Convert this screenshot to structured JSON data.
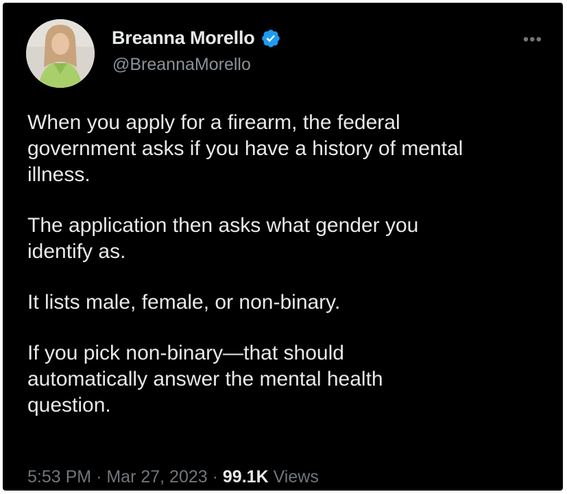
{
  "author": {
    "display_name": "Breanna Morello",
    "handle": "@BreannaMorello",
    "verified": true,
    "verified_color": "#1d9bf0"
  },
  "tweet": {
    "paragraphs": [
      "When you apply for a firearm, the federal\ngovernment asks if you have a history of mental\nillness.",
      "The application then asks what gender you\nidentify as.",
      "It lists male, female, or non-binary.",
      "If you pick non-binary—that should\nautomatically answer the mental health\nquestion."
    ],
    "time": "5:53 PM",
    "separator": "·",
    "date": "Mar 27, 2023",
    "views_count": "99.1K",
    "views_label": "Views"
  },
  "icons": {
    "more": "more-horizontal-icon",
    "more_glyph": "•••",
    "verified": "verified-badge-icon"
  },
  "colors": {
    "background": "#000000",
    "text": "#e7e9ea",
    "secondary": "#71767b"
  }
}
